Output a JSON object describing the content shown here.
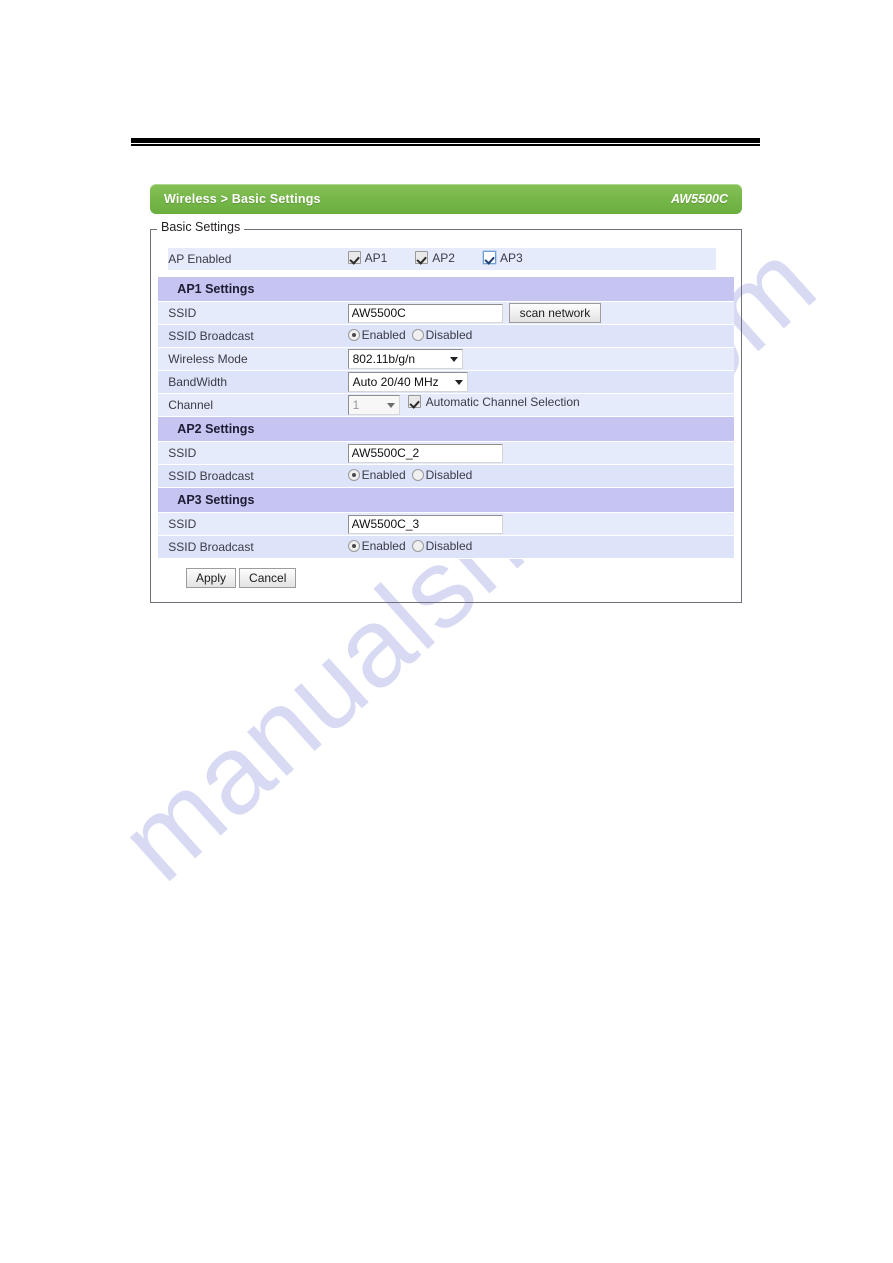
{
  "watermark": {
    "text": "manualshive.com"
  },
  "header": {
    "breadcrumb": "Wireless > Basic Settings",
    "model": "AW5500C",
    "accent_color": "#78b84b"
  },
  "fieldset": {
    "legend": "Basic Settings"
  },
  "ap_enabled": {
    "label": "AP Enabled",
    "options": [
      {
        "label": "AP1",
        "checked": true,
        "focused": false
      },
      {
        "label": "AP2",
        "checked": true,
        "focused": false
      },
      {
        "label": "AP3",
        "checked": true,
        "focused": true
      }
    ]
  },
  "sections": [
    {
      "title": "AP1 Settings",
      "rows": [
        {
          "label": "SSID",
          "type": "text-with-button",
          "value": "AW5500C",
          "button_label": "scan network"
        },
        {
          "label": "SSID Broadcast",
          "type": "radio",
          "options": [
            {
              "label": "Enabled",
              "selected": true
            },
            {
              "label": "Disabled",
              "selected": false
            }
          ]
        },
        {
          "label": "Wireless Mode",
          "type": "select",
          "value": "802.11b/g/n",
          "width": "mode"
        },
        {
          "label": "BandWidth",
          "type": "select",
          "value": "Auto 20/40 MHz",
          "width": "bw"
        },
        {
          "label": "Channel",
          "type": "select-with-checkbox",
          "value": "1",
          "width": "chan",
          "disabled": true,
          "checkbox_label": "Automatic Channel Selection",
          "checkbox_checked": true
        }
      ]
    },
    {
      "title": "AP2 Settings",
      "rows": [
        {
          "label": "SSID",
          "type": "text",
          "value": "AW5500C_2"
        },
        {
          "label": "SSID Broadcast",
          "type": "radio",
          "options": [
            {
              "label": "Enabled",
              "selected": true
            },
            {
              "label": "Disabled",
              "selected": false
            }
          ]
        }
      ]
    },
    {
      "title": "AP3 Settings",
      "rows": [
        {
          "label": "SSID",
          "type": "text",
          "value": "AW5500C_3"
        },
        {
          "label": "SSID Broadcast",
          "type": "radio",
          "options": [
            {
              "label": "Enabled",
              "selected": true
            },
            {
              "label": "Disabled",
              "selected": false
            }
          ]
        }
      ]
    }
  ],
  "actions": {
    "apply_label": "Apply",
    "cancel_label": "Cancel"
  }
}
